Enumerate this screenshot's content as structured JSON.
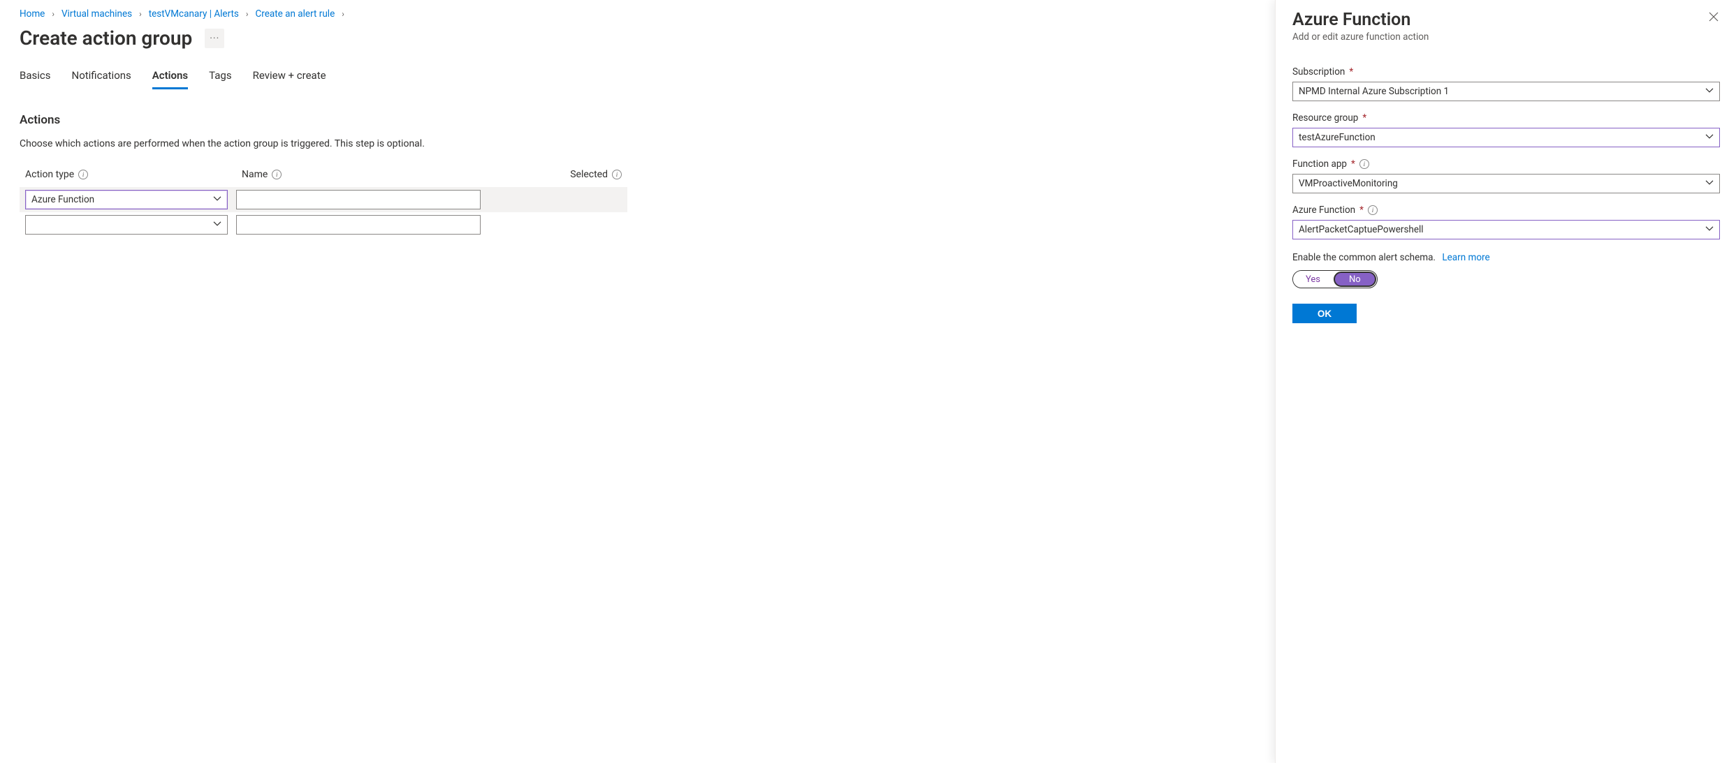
{
  "breadcrumbs": {
    "home": "Home",
    "vm": "Virtual machines",
    "resource": "testVMcanary | Alerts",
    "rule": "Create an alert rule"
  },
  "page": {
    "title": "Create action group"
  },
  "tabs": {
    "basics": "Basics",
    "notifications": "Notifications",
    "actions": "Actions",
    "tags": "Tags",
    "review": "Review + create"
  },
  "actions": {
    "heading": "Actions",
    "description": "Choose which actions are performed when the action group is triggered. This step is optional.",
    "cols": {
      "type": "Action type",
      "name": "Name",
      "selected": "Selected"
    },
    "rows": {
      "r0_type": "Azure Function",
      "r0_name": "",
      "r1_type": "",
      "r1_name": ""
    }
  },
  "blade": {
    "title": "Azure Function",
    "subtitle": "Add or edit azure function action",
    "labels": {
      "subscription": "Subscription",
      "resource_group": "Resource group",
      "function_app": "Function app",
      "azure_function": "Azure Function"
    },
    "values": {
      "subscription": "NPMD Internal Azure Subscription 1",
      "resource_group": "testAzureFunction",
      "function_app": "VMProactiveMonitoring",
      "azure_function": "AlertPacketCaptuePowershell"
    },
    "schema_text": "Enable the common alert schema.",
    "learn_more": "Learn more",
    "toggle": {
      "yes": "Yes",
      "no": "No"
    },
    "ok": "OK"
  }
}
